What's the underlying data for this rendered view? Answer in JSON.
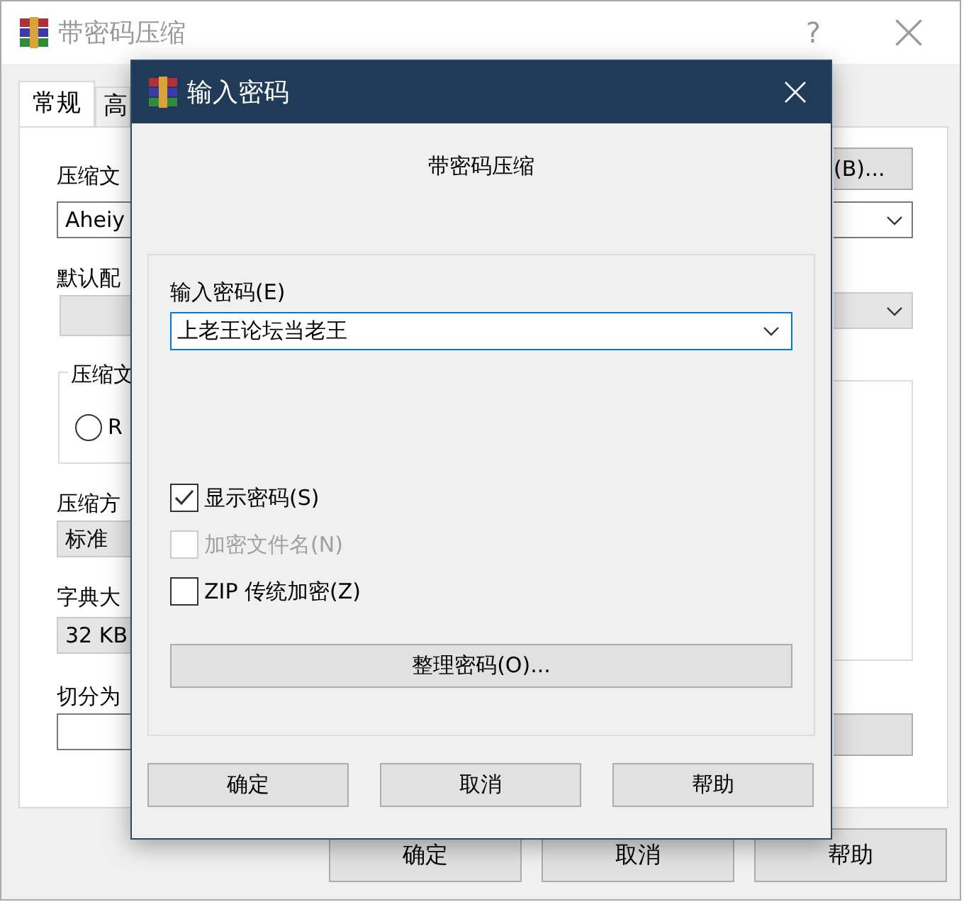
{
  "background_window": {
    "title": "带密码压缩",
    "help": "?",
    "tabs": [
      {
        "label": "常规",
        "selected": true
      },
      {
        "label": "高",
        "selected": false
      }
    ],
    "archive_name_label": "压缩文",
    "archive_name": "Aheiy",
    "profile_label": "默认配",
    "format_group": {
      "legend": "压缩文",
      "option": {
        "label": "R",
        "selected": false
      }
    },
    "method_label": "压缩方",
    "method": "标准",
    "dictionary_label": "字典大",
    "dictionary": "32 KB",
    "split_label": "切分为",
    "browse_button": "(B)...",
    "buttons": [
      "确定",
      "取消",
      "帮助"
    ]
  },
  "dialog": {
    "title": "输入密码",
    "subtitle": "带密码压缩",
    "password_label": "输入密码(E)",
    "password": "上老王论坛当老王",
    "options": [
      {
        "label": "显示密码(S)",
        "checked": true,
        "disabled": false
      },
      {
        "label": "加密文件名(N)",
        "checked": false,
        "disabled": true
      },
      {
        "label": "ZIP 传统加密(Z)",
        "checked": false,
        "disabled": false
      }
    ],
    "organize_button": "整理密码(O)...",
    "buttons": [
      "确定",
      "取消",
      "帮助"
    ]
  }
}
